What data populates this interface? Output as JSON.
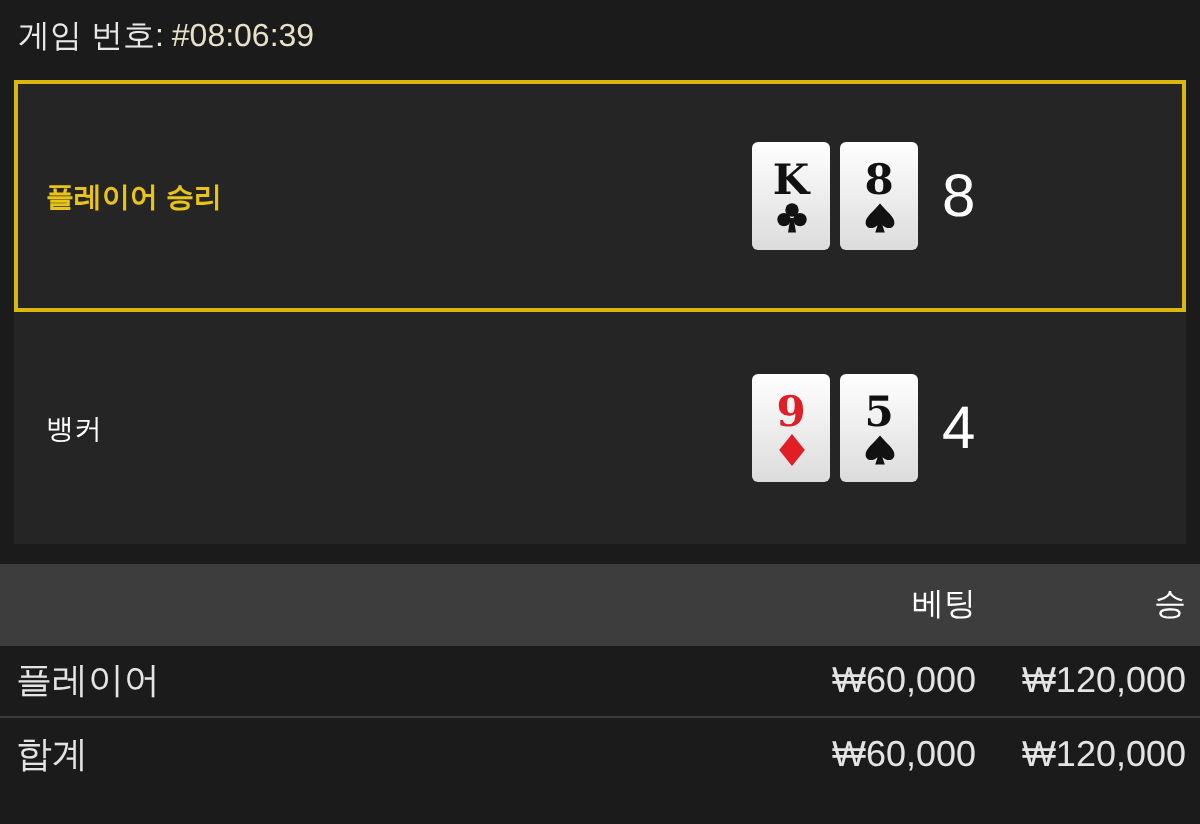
{
  "game": {
    "label": "게임 번호:",
    "number": "#08:06:39"
  },
  "hands": [
    {
      "label": "플레이어 승리",
      "winner": true,
      "score": "8",
      "cards": [
        {
          "rank": "K",
          "kind": "clubs"
        },
        {
          "rank": "8",
          "kind": "spades"
        }
      ]
    },
    {
      "label": "뱅커",
      "winner": false,
      "score": "4",
      "cards": [
        {
          "rank": "9",
          "kind": "diamonds"
        },
        {
          "rank": "5",
          "kind": "spades"
        }
      ]
    }
  ],
  "table": {
    "columns": [
      "베팅",
      "승"
    ],
    "rows": [
      {
        "name": "플레이어",
        "bet": "₩60,000",
        "win": "₩120,000"
      },
      {
        "name": "합계",
        "bet": "₩60,000",
        "win": "₩120,000"
      }
    ]
  }
}
